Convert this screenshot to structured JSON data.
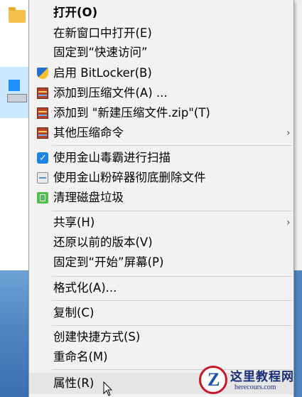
{
  "menu": {
    "items": [
      {
        "label": "打开(O)",
        "icon": "",
        "bold": true,
        "submenu": false
      },
      {
        "label": "在新窗口中打开(E)",
        "icon": "",
        "submenu": false
      },
      {
        "label": "固定到“快速访问”",
        "icon": "",
        "submenu": false
      },
      {
        "label": "启用 BitLocker(B)",
        "icon": "shield-icon",
        "submenu": false
      },
      {
        "label": "添加到压缩文件(A) ...",
        "icon": "archive-icon",
        "submenu": false
      },
      {
        "label": "添加到 \"新建压缩文件.zip\"(T)",
        "icon": "archive-icon",
        "submenu": false
      },
      {
        "label": "其他压缩命令",
        "icon": "archive-icon",
        "submenu": true
      },
      {
        "label": "使用金山毒霸进行扫描",
        "icon": "kingsoft-antivirus-icon",
        "submenu": false
      },
      {
        "label": "使用金山粉碎器彻底删除文件",
        "icon": "shredder-icon",
        "submenu": false
      },
      {
        "label": "清理磁盘垃圾",
        "icon": "trash-clean-icon",
        "submenu": false
      },
      {
        "label": "共享(H)",
        "icon": "",
        "submenu": true
      },
      {
        "label": "还原以前的版本(V)",
        "icon": "",
        "submenu": false
      },
      {
        "label": "固定到“开始”屏幕(P)",
        "icon": "",
        "submenu": false
      },
      {
        "label": "格式化(A)...",
        "icon": "",
        "submenu": false
      },
      {
        "label": "复制(C)",
        "icon": "",
        "submenu": false
      },
      {
        "label": "创建快捷方式(S)",
        "icon": "",
        "submenu": false
      },
      {
        "label": "重命名(M)",
        "icon": "",
        "submenu": false
      },
      {
        "label": "属性(R)",
        "icon": "",
        "submenu": false,
        "hover": true
      }
    ],
    "submenu_arrow": "›"
  },
  "watermark": {
    "logo_letter": "Z",
    "title": "这里教程网",
    "subtitle": "herecours.com"
  },
  "colors": {
    "menu_bg": "#f2f2f2",
    "hover_bg": "#e5e5e5",
    "separator": "#cfcfcf",
    "selection": "#cce8ff"
  }
}
